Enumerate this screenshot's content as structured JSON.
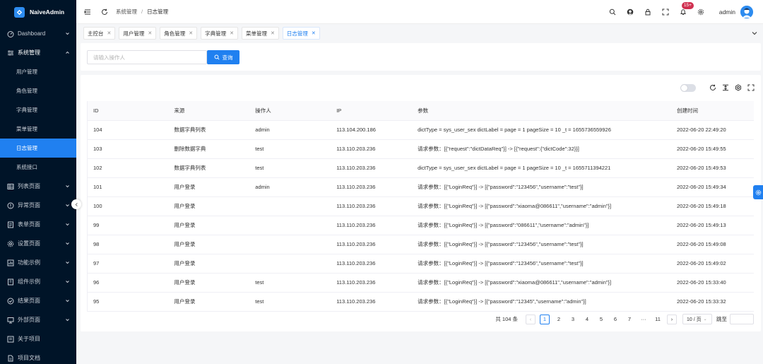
{
  "app": {
    "title": "NaiveAdmin"
  },
  "sidebar": {
    "items": [
      {
        "label": "Dashboard",
        "icon": "dashboard-icon"
      },
      {
        "label": "系统管理",
        "icon": "sliders-icon",
        "open": true,
        "children": [
          "用户管理",
          "角色管理",
          "字典管理",
          "菜单管理",
          "日志管理",
          "系统接口"
        ],
        "active_child": "日志管理"
      },
      {
        "label": "列表页面",
        "icon": "table-icon"
      },
      {
        "label": "异常页面",
        "icon": "warning-icon"
      },
      {
        "label": "表单页面",
        "icon": "form-icon"
      },
      {
        "label": "设置页面",
        "icon": "gear-icon"
      },
      {
        "label": "功能示例",
        "icon": "feature-icon"
      },
      {
        "label": "组件示例",
        "icon": "component-icon"
      },
      {
        "label": "结果页面",
        "icon": "check-circle-icon"
      },
      {
        "label": "外部页面",
        "icon": "monitor-icon"
      },
      {
        "label": "关于项目",
        "icon": "info-box-icon"
      },
      {
        "label": "项目文档",
        "icon": "doc-icon"
      }
    ]
  },
  "header": {
    "breadcrumb": [
      "系统管理",
      "日志管理"
    ],
    "badge": "15+",
    "username": "admin"
  },
  "tabs": [
    {
      "label": "主控台",
      "active": false
    },
    {
      "label": "用户管理",
      "active": false
    },
    {
      "label": "角色管理",
      "active": false
    },
    {
      "label": "字典管理",
      "active": false
    },
    {
      "label": "菜单管理",
      "active": false
    },
    {
      "label": "日志管理",
      "active": true
    }
  ],
  "search": {
    "placeholder": "请输入操作人",
    "button_label": "查询"
  },
  "table": {
    "columns": [
      "ID",
      "来源",
      "操作人",
      "IP",
      "参数",
      "创建时间"
    ],
    "rows": [
      [
        "104",
        "数据字典列表",
        "admin",
        "113.104.200.186",
        "dictType = sys_user_sex dictLabel = page = 1 pageSize = 10 _t = 1655736559926",
        "2022-06-20 22:49:20"
      ],
      [
        "103",
        "删除数据字典",
        "test",
        "113.110.203.236",
        "请求参数：[{\"request\":\"dictDataReq\"}] -> [{\"request\":{\"dictCode\":32}}]",
        "2022-06-20 15:49:55"
      ],
      [
        "102",
        "数据字典列表",
        "test",
        "113.110.203.236",
        "dictType = sys_user_sex dictLabel = page = 1 pageSize = 10 _t = 1655711394221",
        "2022-06-20 15:49:53"
      ],
      [
        "101",
        "用户登录",
        "admin",
        "113.110.203.236",
        "请求参数：[{\"LoginReq\"}] -> [{\"password\":\"123456\",\"username\":\"test\"}]",
        "2022-06-20 15:49:34"
      ],
      [
        "100",
        "用户登录",
        "",
        "113.110.203.236",
        "请求参数：[{\"LoginReq\"}] -> [{\"password\":\"xiaoma@086611\",\"username\":\"admin\"}]",
        "2022-06-20 15:49:18"
      ],
      [
        "99",
        "用户登录",
        "",
        "113.110.203.236",
        "请求参数：[{\"LoginReq\"}] -> [{\"password\":\"086611\",\"username\":\"admin\"}]",
        "2022-06-20 15:49:13"
      ],
      [
        "98",
        "用户登录",
        "",
        "113.110.203.236",
        "请求参数：[{\"LoginReq\"}] -> [{\"password\":\"123456\",\"username\":\"test\"}]",
        "2022-06-20 15:49:08"
      ],
      [
        "97",
        "用户登录",
        "",
        "113.110.203.236",
        "请求参数：[{\"LoginReq\"}] -> [{\"password\":\"123456\",\"username\":\"test\"}]",
        "2022-06-20 15:49:02"
      ],
      [
        "96",
        "用户登录",
        "test",
        "113.110.203.236",
        "请求参数：[{\"LoginReq\"}] -> [{\"password\":\"xiaoma@086611\",\"username\":\"admin\"}]",
        "2022-06-20 15:33:40"
      ],
      [
        "95",
        "用户登录",
        "test",
        "113.110.203.236",
        "请求参数：[{\"LoginReq\"}] -> [{\"password\":\"12345\",\"username\":\"admin\"}]",
        "2022-06-20 15:33:32"
      ]
    ]
  },
  "pagination": {
    "total_text": "共 104 条",
    "pages": [
      "1",
      "2",
      "3",
      "4",
      "5",
      "6",
      "7",
      "···",
      "11"
    ],
    "current": "1",
    "page_size": "10 / 页",
    "jump_label": "跳至"
  },
  "colors": {
    "primary": "#2080f0",
    "sidebar_bg": "#001428",
    "badge": "#d03050"
  }
}
